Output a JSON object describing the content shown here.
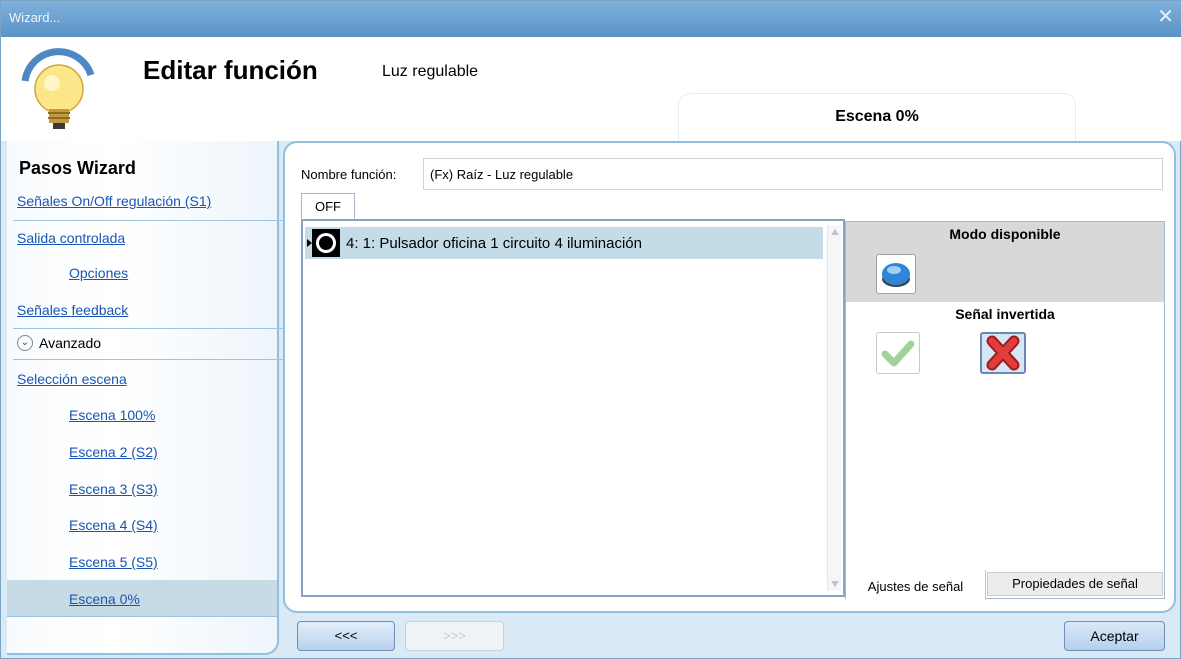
{
  "window": {
    "title": "Wizard...",
    "close_glyph": "✕"
  },
  "header": {
    "title": "Editar función",
    "subtitle": "Luz regulable",
    "scene_tab": "Escena 0%"
  },
  "sidebar": {
    "title": "Pasos Wizard",
    "items": [
      {
        "label": "Señales On/Off regulación (S1)"
      },
      {
        "label": "Salida controlada"
      },
      {
        "label": "Opciones"
      },
      {
        "label": "Señales feedback"
      },
      {
        "label": "Selección escena"
      },
      {
        "label": "Escena 100%"
      },
      {
        "label": "Escena 2 (S2)"
      },
      {
        "label": "Escena 3 (S3)"
      },
      {
        "label": "Escena 4 (S4)"
      },
      {
        "label": "Escena 5 (S5)"
      },
      {
        "label": "Escena 0%"
      }
    ],
    "avanzado": {
      "label": "Avanzado",
      "icon": "chevron-down-icon"
    }
  },
  "main": {
    "nombre_label": "Nombre función:",
    "nombre_value": "(Fx) Raíz - Luz regulable",
    "tab_off": "OFF",
    "list": [
      {
        "text": "4: 1: Pulsador oficina 1 circuito 4 iluminación",
        "icon": "pushbutton-icon"
      }
    ],
    "props": {
      "modo_title": "Modo disponible",
      "senal_title": "Señal invertida",
      "tab_ajustes": "Ajustes de señal",
      "tab_propiedades": "Propiedades de señal"
    }
  },
  "footer": {
    "prev_label": "<<<",
    "next_label": ">>>",
    "ok_label": "Aceptar"
  },
  "colors": {
    "link": "#1a54b4",
    "selected_row": "#c3dce8",
    "window_bg": "#d9eaf6",
    "titlebar": "#5b93c6"
  }
}
